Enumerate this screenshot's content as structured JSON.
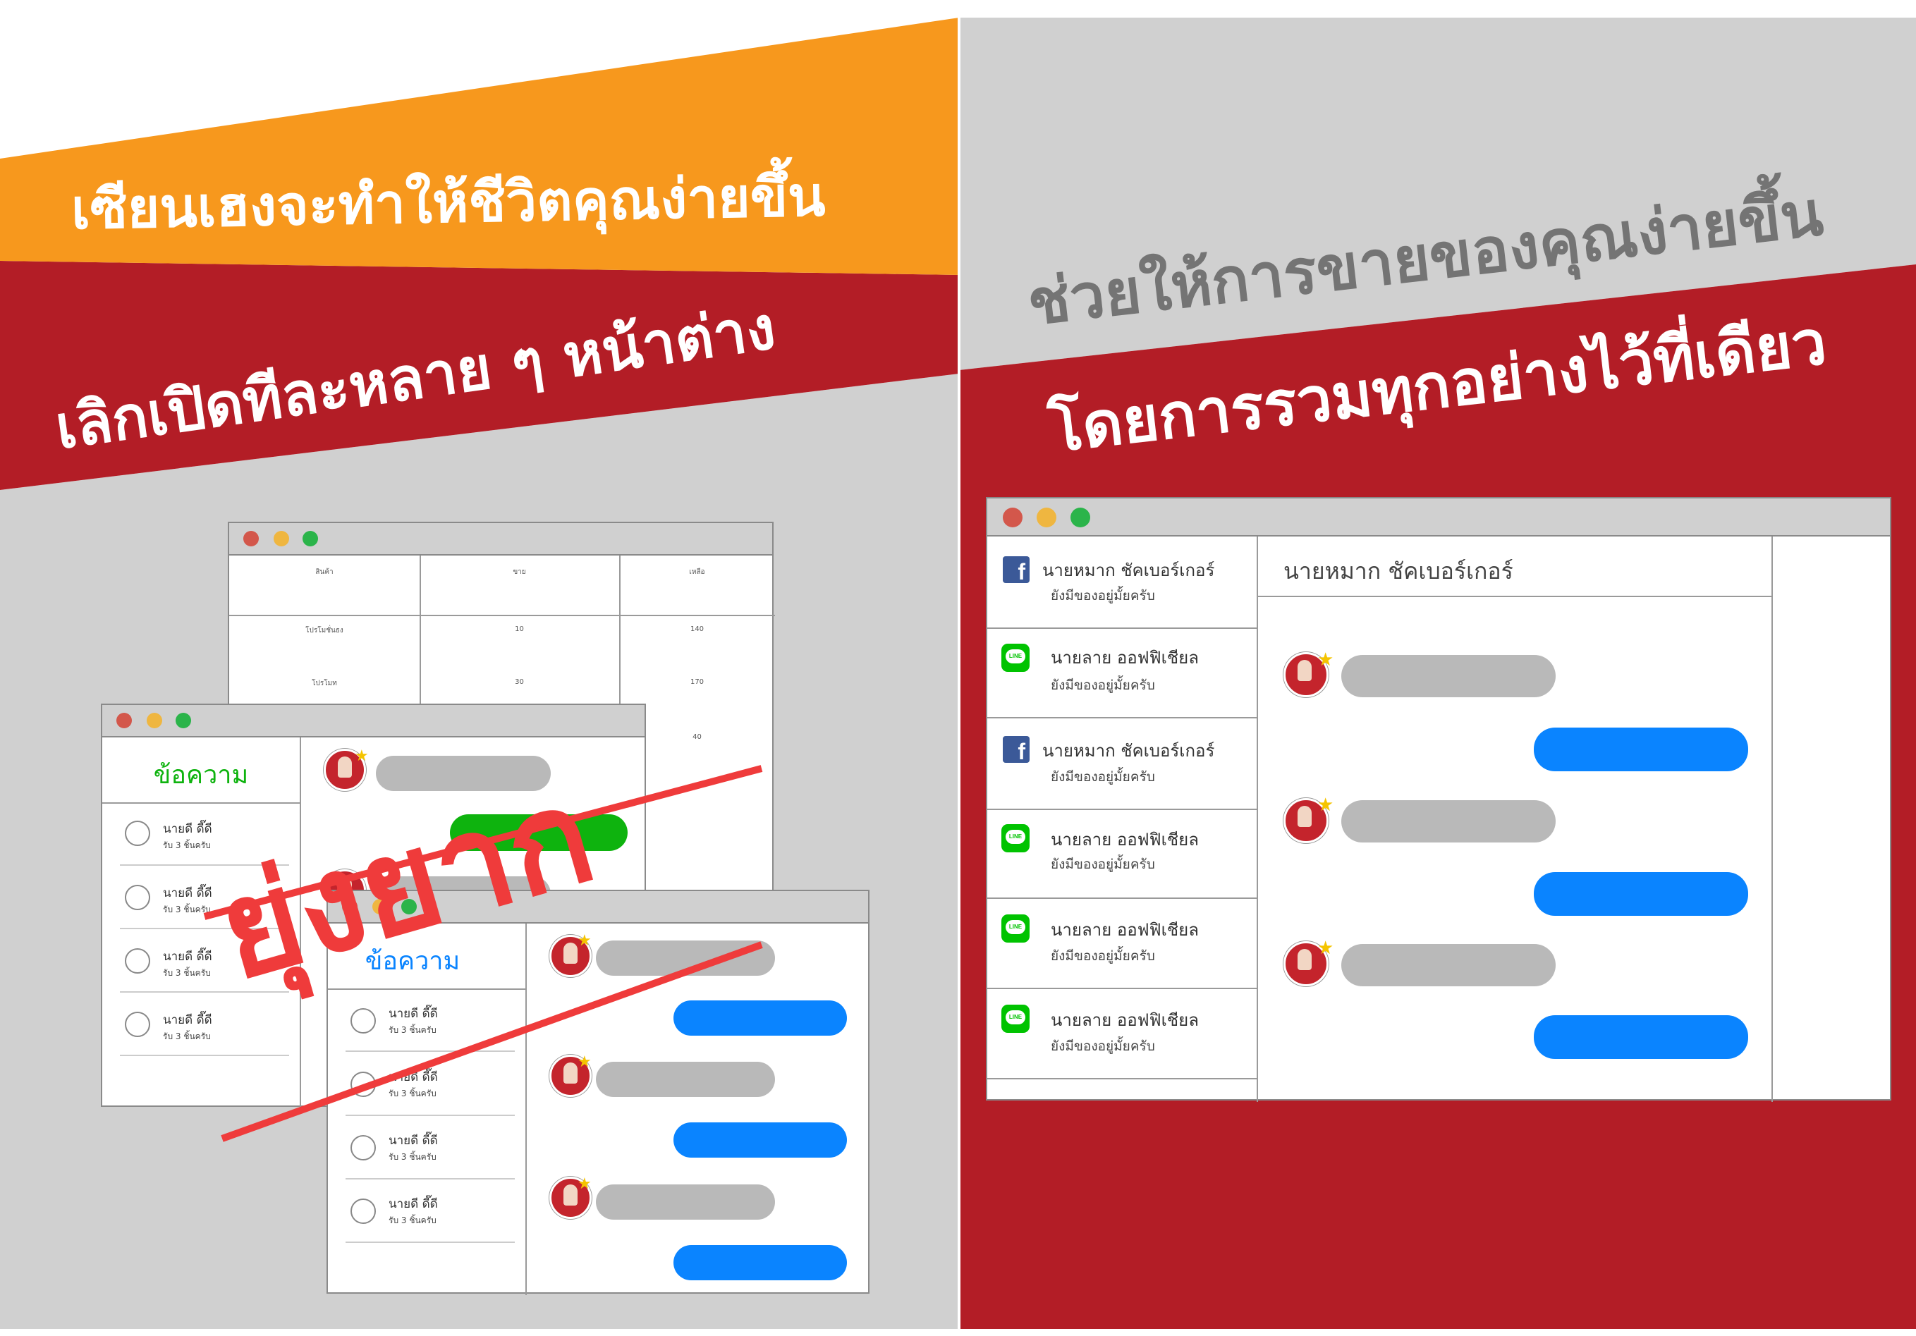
{
  "banners": {
    "top_left": "เซียนเฮงจะทำให้ชีวิตคุณง่ายขึ้น",
    "mid_left": "เลิกเปิดทีละหลาย ๆ หน้าต่าง",
    "top_right": "ช่วยให้การขายของคุณง่ายขึ้น",
    "mid_right": "โดยการรวมทุกอย่างไว้ที่เดียว"
  },
  "colors": {
    "orange": "#f7981d",
    "red": "#b31d26",
    "grey": "#d0d0d0",
    "stamp": "#ef3b3b",
    "blue_bubble": "#0a84ff",
    "green_bubble": "#0eb30e"
  },
  "stamp": "ยุ่งยาก",
  "table_window": {
    "headers": [
      "สินค้า",
      "ขาย",
      "เหลือ"
    ],
    "rows": [
      [
        "โปรโมชั่นธง",
        "10",
        "140"
      ],
      [
        "โปรโมท",
        "30",
        "170"
      ],
      [
        "",
        "",
        "40"
      ]
    ]
  },
  "chat_window_green": {
    "header": "ข้อความ",
    "contacts": [
      {
        "name": "นายดี ดี๊ดี",
        "sub": "รับ 3 ชิ้นครับ"
      },
      {
        "name": "นายดี ดี๊ดี",
        "sub": "รับ 3 ชิ้นครับ"
      },
      {
        "name": "นายดี ดี๊ดี",
        "sub": "รับ 3 ชิ้นครับ"
      },
      {
        "name": "นายดี ดี๊ดี",
        "sub": "รับ 3 ชิ้นครับ"
      }
    ]
  },
  "chat_window_blue": {
    "header": "ข้อความ",
    "contacts": [
      {
        "name": "นายดี ดี๊ดี",
        "sub": "รับ 3 ชิ้นครับ"
      },
      {
        "name": "นายดี ดี๊ดี",
        "sub": "รับ 3 ชิ้นครับ"
      },
      {
        "name": "นายดี ดี๊ดี",
        "sub": "รับ 3 ชิ้นครับ"
      },
      {
        "name": "นายดี ดี๊ดี",
        "sub": "รับ 3 ชิ้นครับ"
      }
    ]
  },
  "unified_window": {
    "chat_title": "นายหมาก ชัคเบอร์เกอร์",
    "conversations": [
      {
        "channel": "facebook-icon",
        "name": "นายหมาก ชัคเบอร์เกอร์",
        "sub": "ยังมีของอยู่มั้ยครับ"
      },
      {
        "channel": "line-icon",
        "name": "นายลาย ออฟฟิเชียล",
        "sub": "ยังมีของอยู่มั้ยครับ"
      },
      {
        "channel": "facebook-icon",
        "name": "นายหมาก ชัคเบอร์เกอร์",
        "sub": "ยังมีของอยู่มั้ยครับ"
      },
      {
        "channel": "line-icon",
        "name": "นายลาย ออฟฟิเชียล",
        "sub": "ยังมีของอยู่มั้ยครับ"
      },
      {
        "channel": "line-icon",
        "name": "นายลาย ออฟฟิเชียล",
        "sub": "ยังมีของอยู่มั้ยครับ"
      },
      {
        "channel": "line-icon",
        "name": "นายลาย ออฟฟิเชียล",
        "sub": "ยังมีของอยู่มั้ยครับ"
      }
    ],
    "line_badge": "LINE"
  }
}
